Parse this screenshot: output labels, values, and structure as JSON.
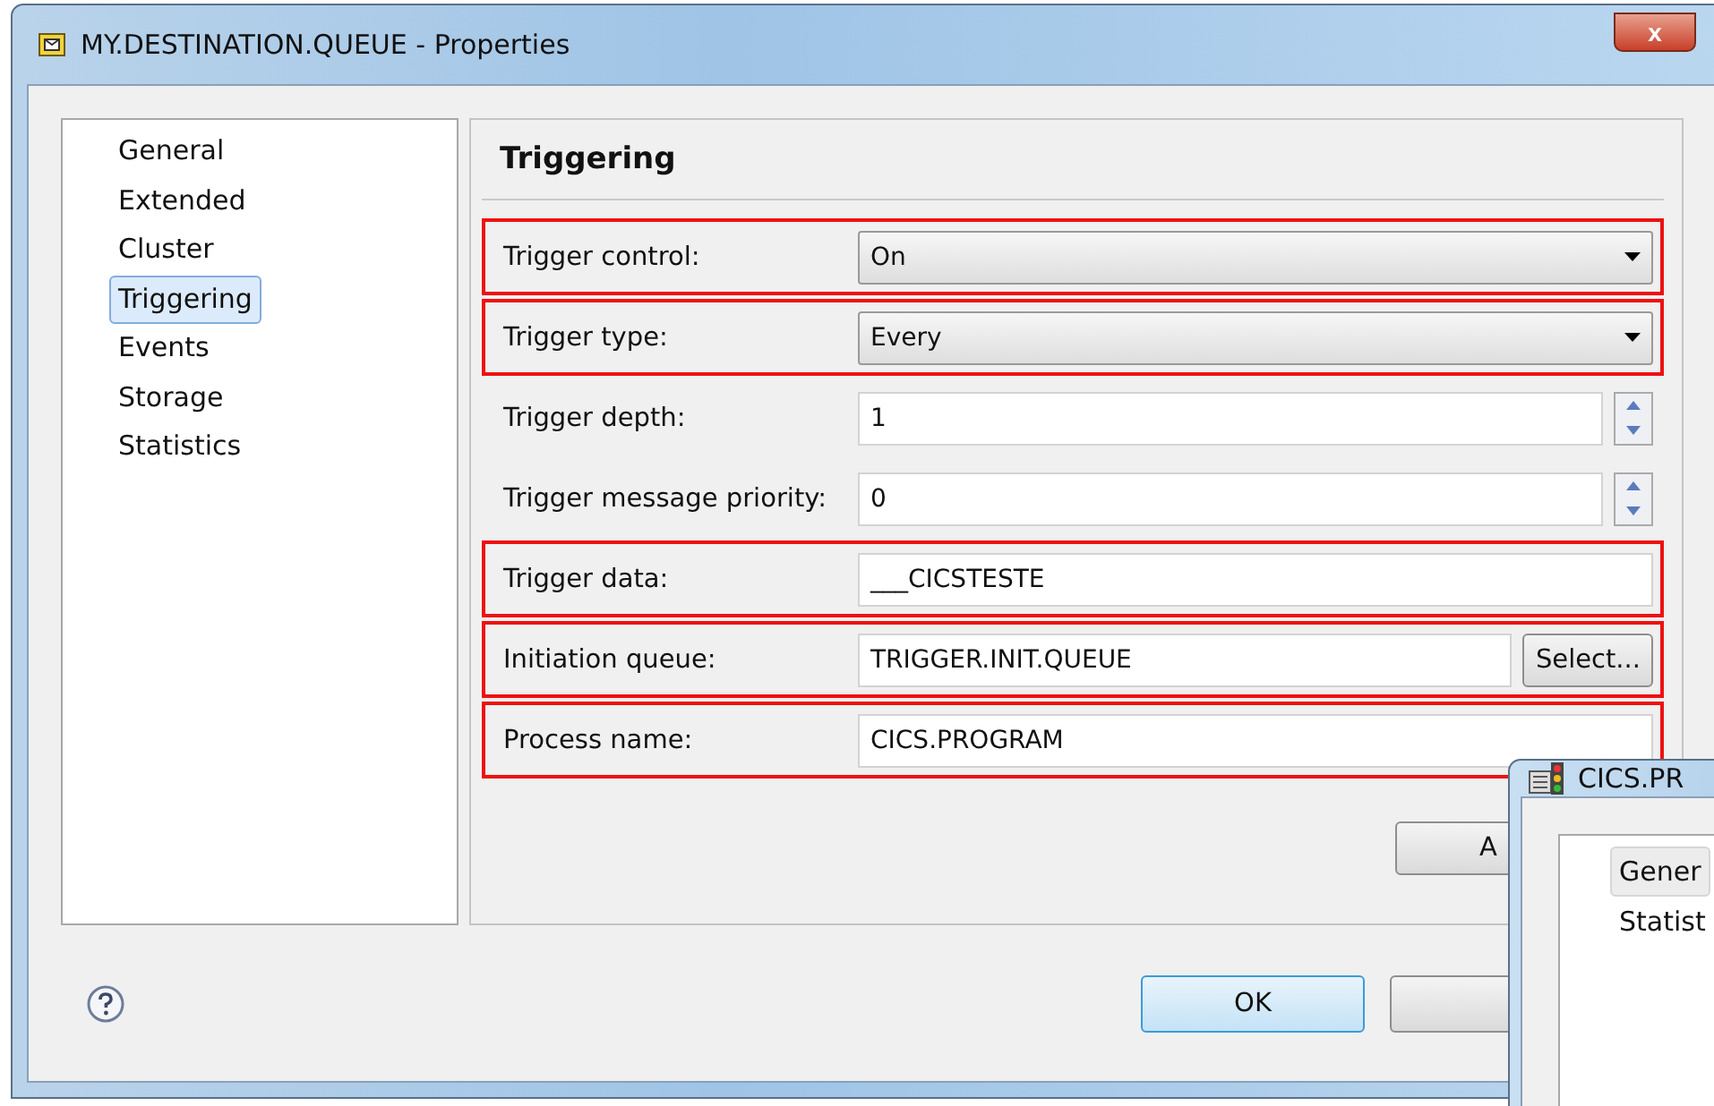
{
  "window": {
    "title": "MY.DESTINATION.QUEUE - Properties",
    "close": "x"
  },
  "sidebar": {
    "items": [
      {
        "label": "General",
        "selected": false
      },
      {
        "label": "Extended",
        "selected": false
      },
      {
        "label": "Cluster",
        "selected": false
      },
      {
        "label": "Triggering",
        "selected": true
      },
      {
        "label": "Events",
        "selected": false
      },
      {
        "label": "Storage",
        "selected": false
      },
      {
        "label": "Statistics",
        "selected": false
      }
    ]
  },
  "panel": {
    "heading": "Triggering",
    "rows": [
      {
        "label": "Trigger control:",
        "kind": "dropdown",
        "value": "On",
        "highlighted": true
      },
      {
        "label": "Trigger type:",
        "kind": "dropdown",
        "value": "Every",
        "highlighted": true
      },
      {
        "label": "Trigger depth:",
        "kind": "spinner",
        "value": "1",
        "highlighted": false
      },
      {
        "label": "Trigger message priority:",
        "kind": "spinner",
        "value": "0",
        "highlighted": false
      },
      {
        "label": "Trigger data:",
        "kind": "text",
        "value": "___CICSTESTE",
        "highlighted": true
      },
      {
        "label": "Initiation queue:",
        "kind": "text_button",
        "value": "TRIGGER.INIT.QUEUE",
        "button": "Select...",
        "highlighted": true
      },
      {
        "label": "Process name:",
        "kind": "text",
        "value": "CICS.PROGRAM",
        "highlighted": true
      }
    ],
    "apply_button": "A"
  },
  "footer": {
    "ok_button": "OK"
  },
  "second_window": {
    "title": "CICS.PR",
    "items": [
      {
        "label": "Gener",
        "selected": true
      },
      {
        "label": "Statist",
        "selected": false
      }
    ]
  }
}
